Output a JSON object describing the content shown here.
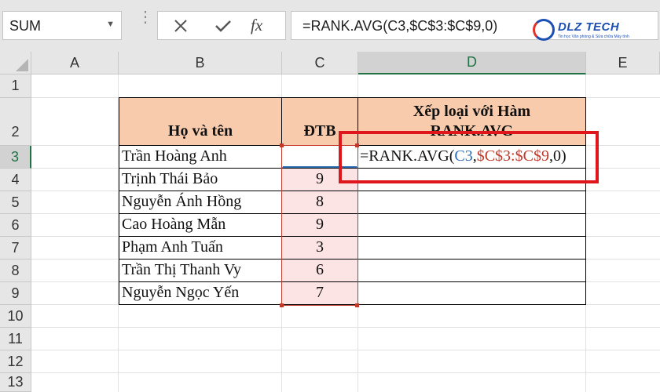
{
  "formula_bar": {
    "name_box": "SUM",
    "fx": "fx",
    "formula": "=RANK.AVG(C3,$C$3:$C$9,0)"
  },
  "logo": {
    "text": "DLZ TECH",
    "sub": "Tin học Văn phòng & Sửa chữa Máy tính"
  },
  "columns": [
    "A",
    "B",
    "C",
    "D",
    "E"
  ],
  "rows": [
    "1",
    "2",
    "3",
    "4",
    "5",
    "6",
    "7",
    "8",
    "9",
    "10",
    "11",
    "12",
    "13"
  ],
  "table": {
    "header_name": "Họ và tên",
    "header_score": "ĐTB",
    "header_rank_line1": "Xếp loại với Hàm",
    "header_rank_line2": "RANK.AVG",
    "names": [
      "Trần Hoàng Anh",
      "Trịnh Thái Bảo",
      "Nguyễn Ánh Hồng",
      "Cao Hoàng Mẫn",
      "Phạm Anh Tuấn",
      "Trần Thị Thanh Vy",
      "Nguyễn Ngọc Yến"
    ],
    "scores": [
      "",
      "9",
      "8",
      "9",
      "3",
      "6",
      "7"
    ]
  },
  "editing_formula": {
    "prefix": "=RANK.AVG(",
    "ref": "C3",
    "sep1": ",",
    "range": "$C$3:$C$9",
    "suffix": ",0)",
    "ref_color": "#2f6db5",
    "range_color": "#c0392b"
  },
  "colors": {
    "header_fill": "#f8cbad",
    "highlight_box": "#e0161d",
    "selection": "#217346"
  }
}
